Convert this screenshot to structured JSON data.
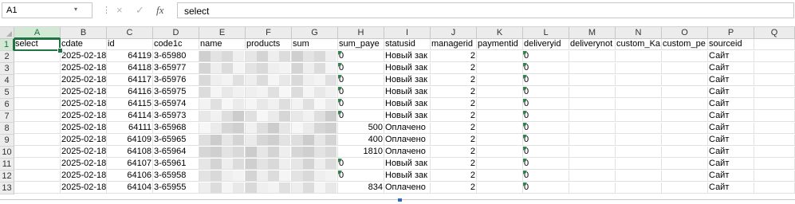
{
  "formula_bar": {
    "name_box": "A1",
    "name_box_arrow": "▾",
    "separator": "⋮",
    "cancel_icon": "×",
    "confirm_icon": "✓",
    "fx": "fx",
    "formula": "select"
  },
  "columns": [
    "A",
    "B",
    "C",
    "D",
    "E",
    "F",
    "G",
    "H",
    "I",
    "J",
    "K",
    "L",
    "M",
    "N",
    "O",
    "P",
    "Q"
  ],
  "row_numbers": [
    "1",
    "2",
    "3",
    "4",
    "5",
    "6",
    "7",
    "8",
    "9",
    "10",
    "11",
    "12",
    "13"
  ],
  "header_row": [
    "select",
    "cdate",
    "id",
    "code1c",
    "name",
    "products",
    "sum",
    "sum_paye",
    "statusid",
    "managerid",
    "paymentid",
    "deliveryid",
    "deliverynot",
    "custom_Kа",
    "custom_pе",
    "sourceid",
    ""
  ],
  "rows": [
    {
      "cdate": "2025-02-18",
      "id": "64119",
      "code1c": "3-65980",
      "sum_paye": "0",
      "statusid": "Новый зак",
      "managerid": "2",
      "deliveryid": "0",
      "sourceid": "Сайт"
    },
    {
      "cdate": "2025-02-18",
      "id": "64118",
      "code1c": "3-65977",
      "sum_paye": "0",
      "statusid": "Новый зак",
      "managerid": "2",
      "deliveryid": "0",
      "sourceid": "Сайт"
    },
    {
      "cdate": "2025-02-18",
      "id": "64117",
      "code1c": "3-65976",
      "sum_paye": "0",
      "statusid": "Новый зак",
      "managerid": "2",
      "deliveryid": "0",
      "sourceid": "Сайт"
    },
    {
      "cdate": "2025-02-18",
      "id": "64116",
      "code1c": "3-65975",
      "sum_paye": "0",
      "statusid": "Новый зак",
      "managerid": "2",
      "deliveryid": "0",
      "sourceid": "Сайт"
    },
    {
      "cdate": "2025-02-18",
      "id": "64115",
      "code1c": "3-65974",
      "sum_paye": "0",
      "statusid": "Новый зак",
      "managerid": "2",
      "deliveryid": "0",
      "sourceid": "Сайт"
    },
    {
      "cdate": "2025-02-18",
      "id": "64114",
      "code1c": "3-65973",
      "sum_paye": "0",
      "statusid": "Новый зак",
      "managerid": "2",
      "deliveryid": "0",
      "sourceid": "Сайт"
    },
    {
      "cdate": "2025-02-18",
      "id": "64111",
      "code1c": "3-65968",
      "sum_paye": "500",
      "statusid": "Оплачено",
      "managerid": "2",
      "deliveryid": "0",
      "sourceid": "Сайт"
    },
    {
      "cdate": "2025-02-18",
      "id": "64109",
      "code1c": "3-65965",
      "sum_paye": "400",
      "statusid": "Оплачено",
      "managerid": "2",
      "deliveryid": "0",
      "sourceid": "Сайт"
    },
    {
      "cdate": "2025-02-18",
      "id": "64108",
      "code1c": "3-65964",
      "sum_paye": "1810",
      "statusid": "Оплачено",
      "managerid": "2",
      "deliveryid": "0",
      "sourceid": "Сайт"
    },
    {
      "cdate": "2025-02-18",
      "id": "64107",
      "code1c": "3-65961",
      "sum_paye": "0",
      "statusid": "Новый зак",
      "managerid": "2",
      "deliveryid": "0",
      "sourceid": "Сайт"
    },
    {
      "cdate": "2025-02-18",
      "id": "64106",
      "code1c": "3-65958",
      "sum_paye": "0",
      "statusid": "Новый зак",
      "managerid": "2",
      "deliveryid": "0",
      "sourceid": "Сайт"
    },
    {
      "cdate": "2025-02-18",
      "id": "64104",
      "code1c": "3-65955",
      "sum_paye": "834",
      "statusid": "Оплачено",
      "managerid": "2",
      "deliveryid": "0",
      "sourceid": "Сайт"
    }
  ],
  "colors": {
    "excel_green": "#217346",
    "selected_header_bg": "#d3e9d6",
    "error_triangle": "#2e8b4e"
  }
}
